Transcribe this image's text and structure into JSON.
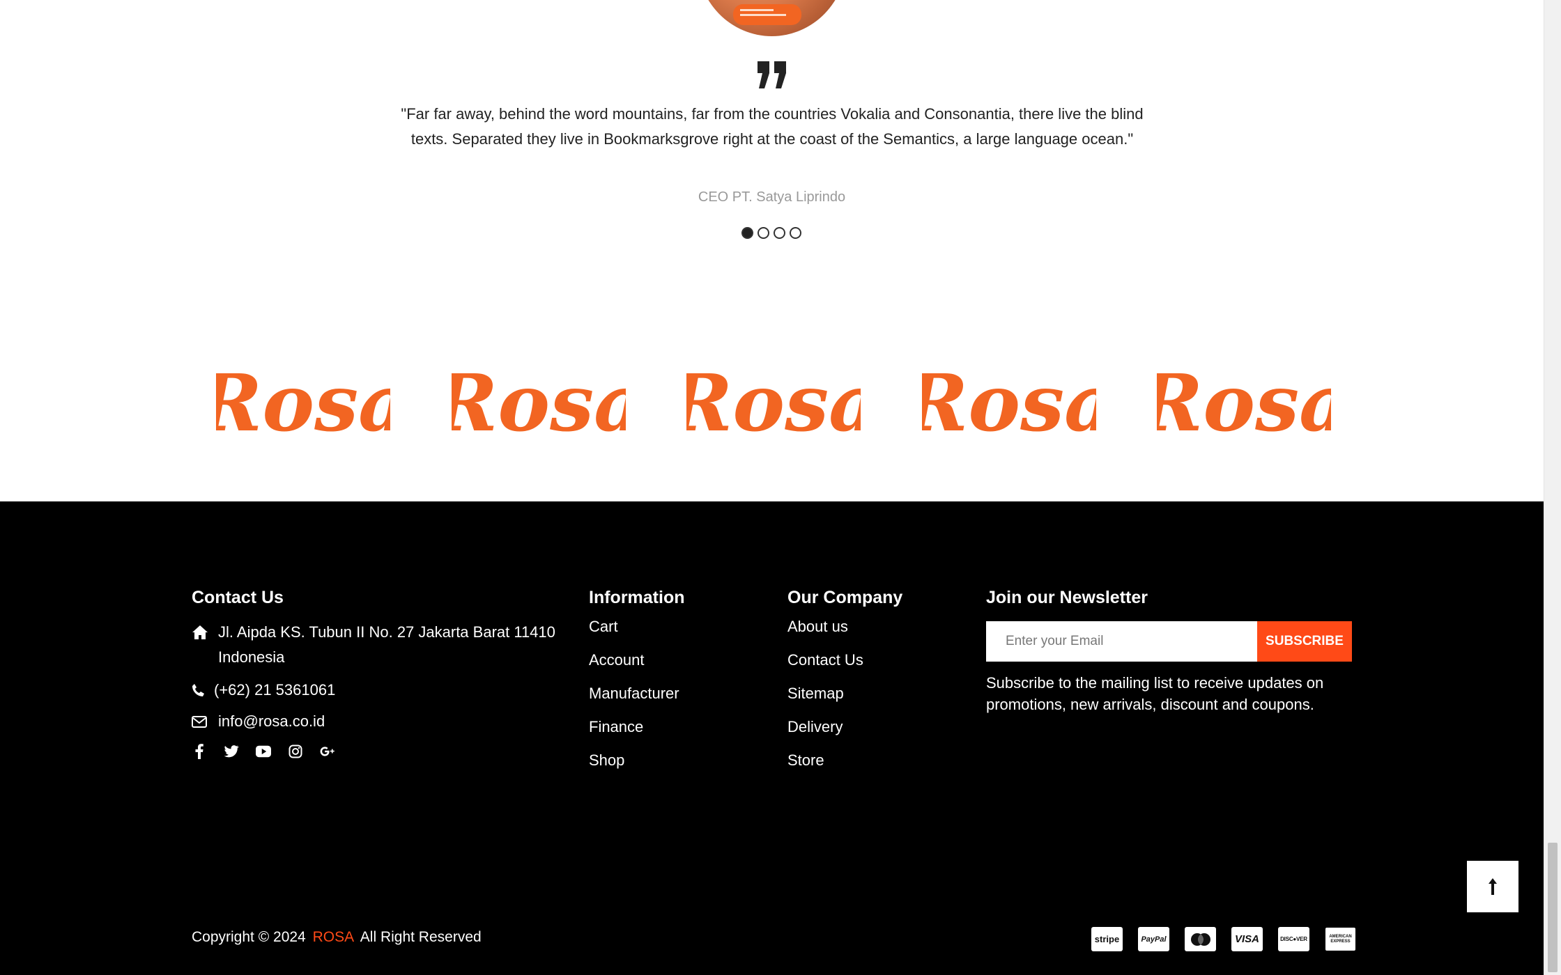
{
  "testimonial": {
    "quote": "\"Far far away, behind the word mountains, far from the countries Vokalia and Consonantia, there live the blind texts. Separated they live in Bookmarksgrove right at the coast of the Semantics, a large language ocean.\"",
    "author": "CEO PT. Satya Liprindo",
    "active_dot": 1,
    "dot_count": 4
  },
  "brands": {
    "logo_text": "Rosa",
    "color": "#f26522",
    "count": 5
  },
  "footer": {
    "contact": {
      "title": "Contact Us",
      "address": "Jl. Aipda KS. Tubun II No. 27 Jakarta Barat 11410 Indonesia",
      "phone": "(+62) 21 5361061",
      "email": "info@rosa.co.id",
      "socials": [
        "facebook-icon",
        "twitter-icon",
        "youtube-icon",
        "instagram-icon",
        "google-plus-icon"
      ]
    },
    "information": {
      "title": "Information",
      "links": [
        "Cart",
        "Account",
        "Manufacturer",
        "Finance",
        "Shop"
      ]
    },
    "company": {
      "title": "Our Company",
      "links": [
        "About us",
        "Contact Us",
        "Sitemap",
        "Delivery",
        "Store"
      ]
    },
    "newsletter": {
      "title": "Join our Newsletter",
      "placeholder": "Enter your Email",
      "button": "SUBSCRIBE",
      "description": "Subscribe to the mailing list to receive updates on promotions, new arrivals, discount and coupons."
    },
    "copyright": {
      "prefix": "Copyright © 2024",
      "brand": "ROSA",
      "suffix": "All Right Reserved"
    },
    "payments": {
      "stripe": "stripe",
      "paypal": "PayPal",
      "mastercard": "mastercard-icon",
      "visa": "VISA",
      "discover": "DISC●VER",
      "amex": "AMERICAN EXPRESS"
    }
  },
  "colors": {
    "accent": "#ff4a17",
    "footer_bg": "#000000",
    "logo": "#f26522"
  }
}
